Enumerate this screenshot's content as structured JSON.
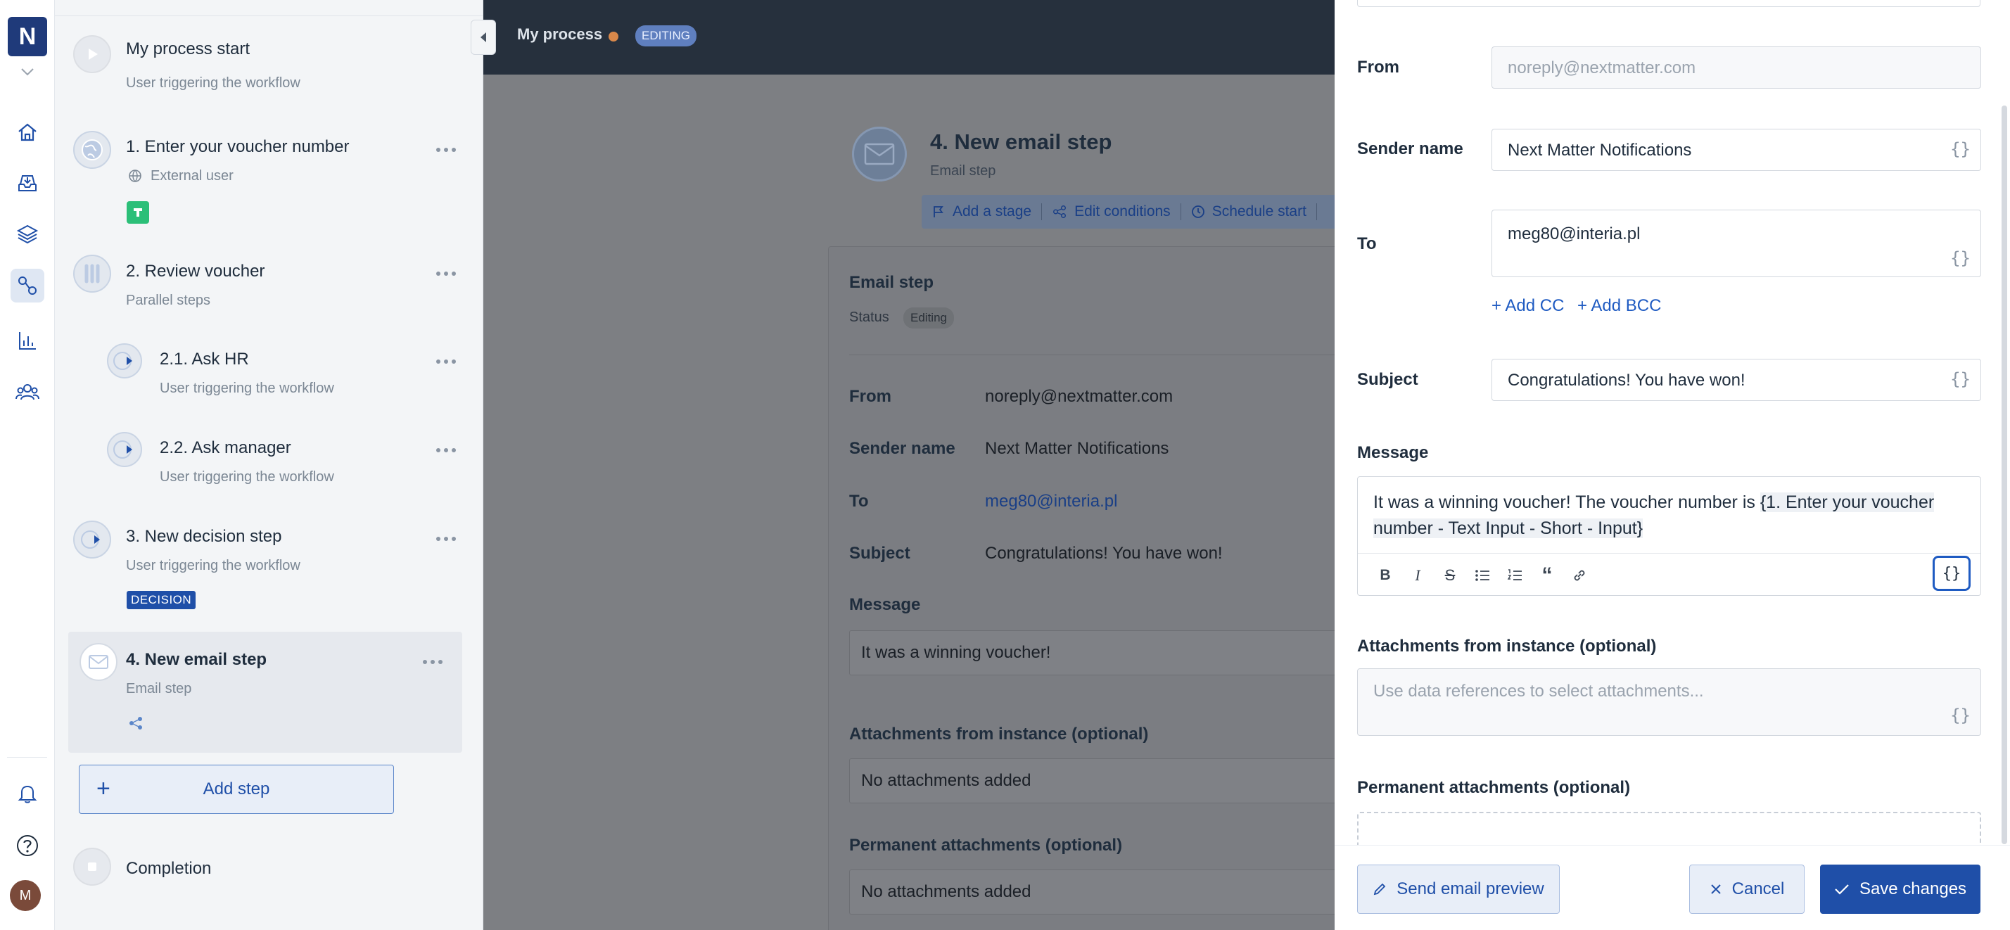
{
  "app": {
    "logo_letter": "N",
    "avatar_initial": "M"
  },
  "topbar": {
    "process_name": "My process",
    "status_badge": "EDITING"
  },
  "steps": {
    "start": {
      "title": "My process start",
      "subtitle": "User triggering the workflow"
    },
    "items": [
      {
        "title": "1. Enter your voucher number",
        "subtitle": "External user"
      },
      {
        "title": "2. Review voucher",
        "subtitle": "Parallel steps"
      },
      {
        "title": "2.1. Ask HR",
        "subtitle": "User triggering the workflow"
      },
      {
        "title": "2.2. Ask manager",
        "subtitle": "User triggering the workflow"
      },
      {
        "title": "3. New decision step",
        "subtitle": "User triggering the workflow",
        "badge": "DECISION"
      },
      {
        "title": "4. New email step",
        "subtitle": "Email step"
      }
    ],
    "add_step_label": "Add step",
    "completion": "Completion"
  },
  "canvas": {
    "title": "4. New email step",
    "subtitle": "Email step",
    "actions": [
      "Add a stage",
      "Edit conditions",
      "Schedule start"
    ],
    "card_title": "Email step",
    "status_label": "Status",
    "status_value": "Editing",
    "from_label": "From",
    "from_value": "noreply@nextmatter.com",
    "sender_label": "Sender name",
    "sender_value": "Next Matter Notifications",
    "to_label": "To",
    "to_value": "meg80@interia.pl",
    "subject_label": "Subject",
    "subject_value": "Congratulations! You have won!",
    "message_label": "Message",
    "message_value": "It was a winning voucher!",
    "attach_label": "Attachments from instance (optional)",
    "attach_value": "No attachments added",
    "perm_label": "Permanent attachments (optional)",
    "perm_value": "No attachments added"
  },
  "panel": {
    "from_label": "From",
    "from_placeholder": "noreply@nextmatter.com",
    "sender_label": "Sender name",
    "sender_value": "Next Matter Notifications",
    "to_label": "To",
    "to_value": "meg80@interia.pl",
    "add_cc": "+ Add CC",
    "add_bcc": "+ Add BCC",
    "subject_label": "Subject",
    "subject_value": "Congratulations! You have won!",
    "message_label": "Message",
    "message_plain": "It was a winning voucher! The voucher number is ",
    "message_ref": "{1. Enter your voucher number - Text Input - Short - Input}",
    "data_ref_glyph": "{}",
    "attach_label": "Attachments from instance (optional)",
    "attach_placeholder": "Use data references to select attachments...",
    "perm_label": "Permanent attachments (optional)",
    "send_preview": "Send email preview",
    "cancel": "Cancel",
    "save": "Save changes"
  },
  "colors": {
    "primary": "#1f4fa8",
    "topbar": "#26303d",
    "accent_dot": "#d9884a",
    "decision": "#1f4fa8",
    "green_badge": "#2bbf78"
  }
}
